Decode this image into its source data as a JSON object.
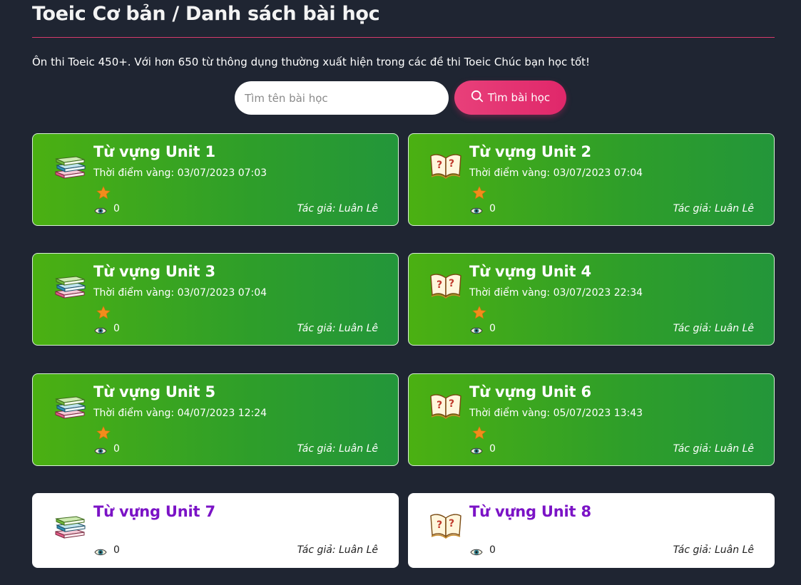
{
  "header": {
    "title": "Toeic Cơ bản / Danh sách bài học",
    "description": "Ôn thi Toeic 450+. Với hơn 650 từ thông dụng thường xuất hiện trong các đề thi Toeic Chúc bạn học tốt!"
  },
  "search": {
    "placeholder": "Tìm tên bài học",
    "value": "",
    "button_label": "Tìm bài học"
  },
  "colors": {
    "background": "#1f2532",
    "accent_pink": "#e0276a",
    "card_green": "#2e9e2a",
    "title_purple": "#7b13c6",
    "star_orange": "#f28c1c"
  },
  "lessons": [
    {
      "title": "Từ vựng Unit 1",
      "date": "Thời điểm vàng: 03/07/2023 07:03",
      "views": "0",
      "author": "Tác giả: Luân Lê",
      "icon": "books-stack-icon",
      "starred": true
    },
    {
      "title": "Từ vựng Unit 2",
      "date": "Thời điểm vàng: 03/07/2023 07:04",
      "views": "0",
      "author": "Tác giả: Luân Lê",
      "icon": "open-book-icon",
      "starred": true
    },
    {
      "title": "Từ vựng Unit 3",
      "date": "Thời điểm vàng: 03/07/2023 07:04",
      "views": "0",
      "author": "Tác giả: Luân Lê",
      "icon": "books-stack-icon",
      "starred": true
    },
    {
      "title": "Từ vựng Unit 4",
      "date": "Thời điểm vàng: 03/07/2023 22:34",
      "views": "0",
      "author": "Tác giả: Luân Lê",
      "icon": "open-book-icon",
      "starred": true
    },
    {
      "title": "Từ vựng Unit 5",
      "date": "Thời điểm vàng: 04/07/2023 12:24",
      "views": "0",
      "author": "Tác giả: Luân Lê",
      "icon": "books-stack-icon",
      "starred": true
    },
    {
      "title": "Từ vựng Unit 6",
      "date": "Thời điểm vàng: 05/07/2023 13:43",
      "views": "0",
      "author": "Tác giả: Luân Lê",
      "icon": "open-book-icon",
      "starred": true
    },
    {
      "title": "Từ vựng Unit 7",
      "date": "",
      "views": "0",
      "author": "Tác giả: Luân Lê",
      "icon": "books-stack-icon",
      "starred": false
    },
    {
      "title": "Từ vựng Unit 8",
      "date": "",
      "views": "0",
      "author": "Tác giả: Luân Lê",
      "icon": "open-book-icon",
      "starred": false
    }
  ]
}
